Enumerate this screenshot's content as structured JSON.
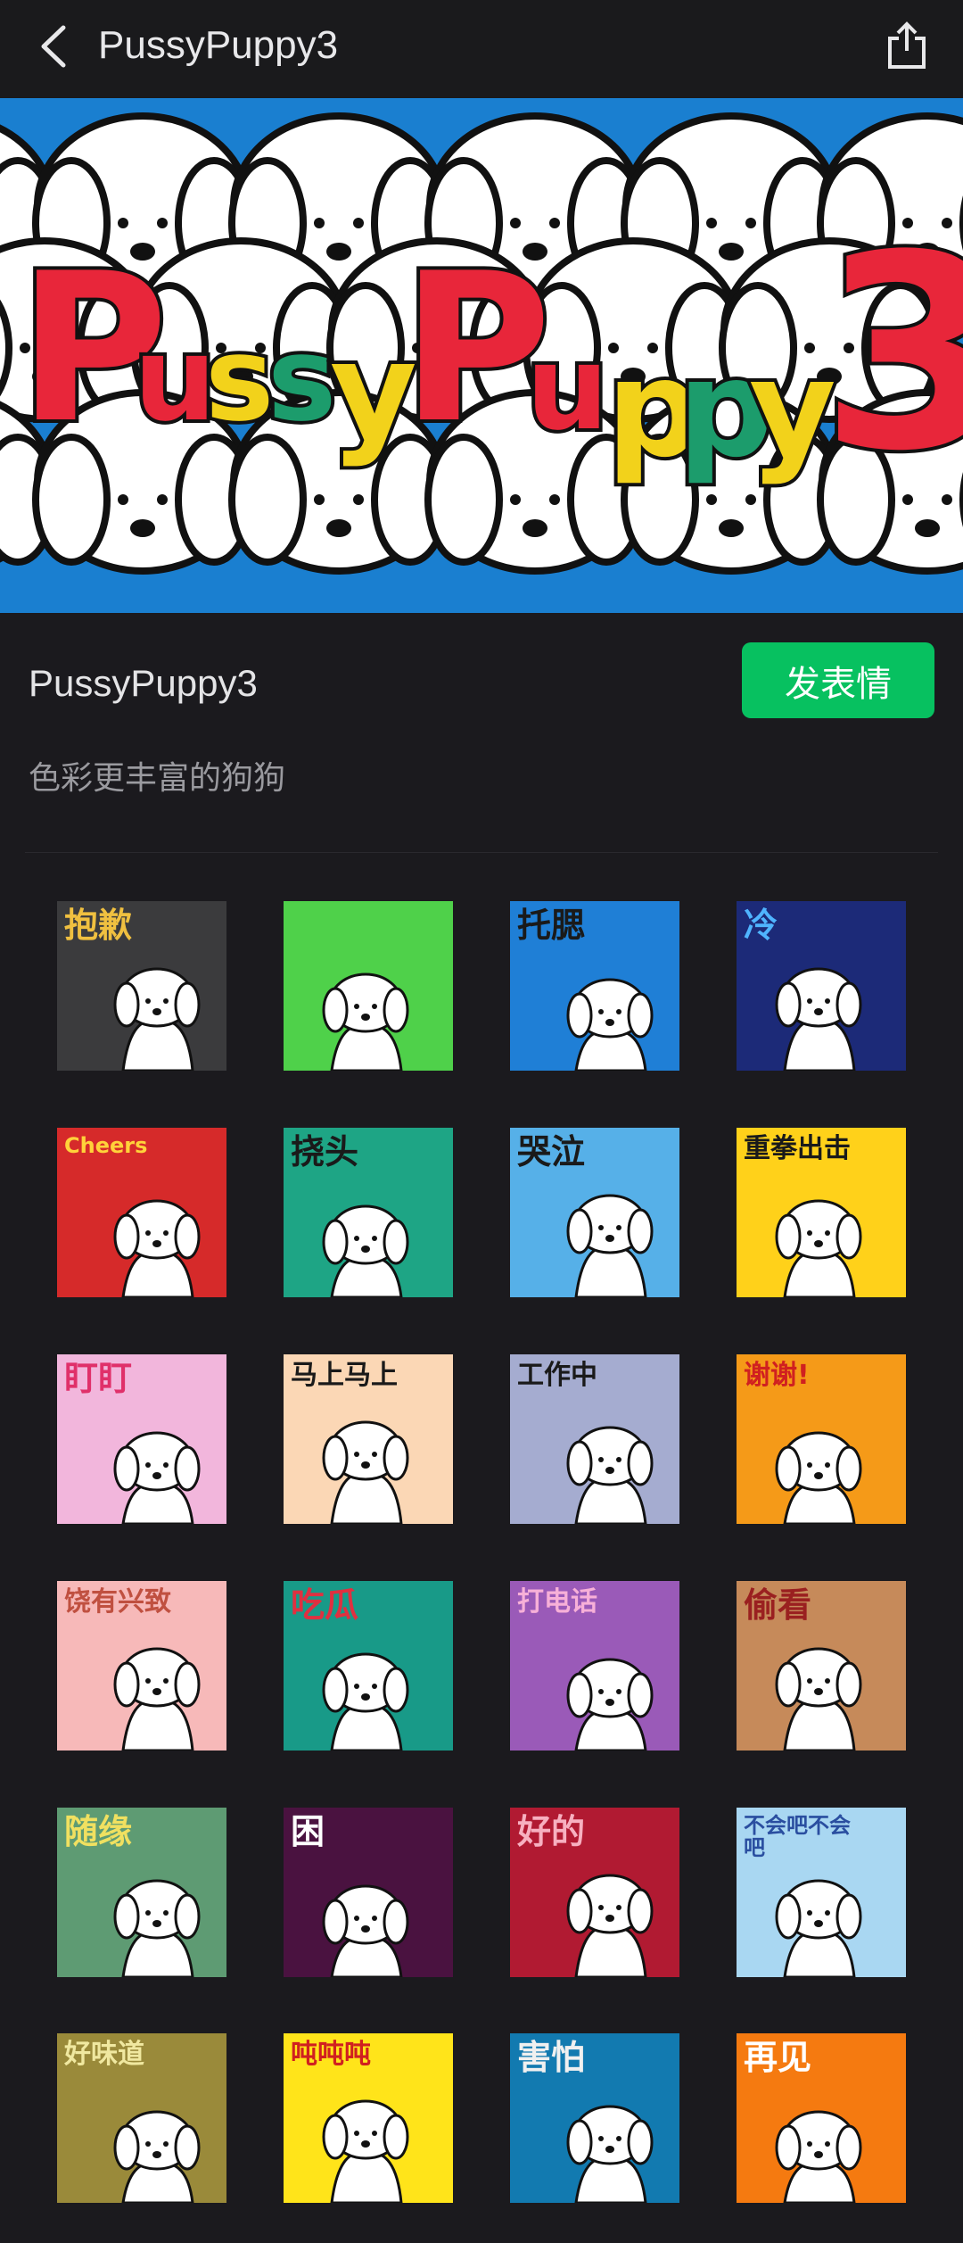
{
  "topbar": {
    "title": "PussyPuppy3",
    "back_icon": "chevron-left-icon",
    "share_icon": "share-icon"
  },
  "banner": {
    "text_letters": [
      "P",
      "u",
      "s",
      "s",
      "y",
      "P",
      "u",
      "p",
      "p",
      "y",
      "3"
    ]
  },
  "pack": {
    "name": "PussyPuppy3",
    "send_label": "发表情",
    "description": "色彩更丰富的狗狗",
    "accent": "#07c160"
  },
  "stickers": [
    {
      "caption": "抱歉",
      "bg": "#3b3b3d",
      "fg": "#f0c040"
    },
    {
      "caption": "",
      "bg": "#4fd14a",
      "fg": "#222222"
    },
    {
      "caption": "托腮",
      "bg": "#1f7fd6",
      "fg": "#1a1a1a"
    },
    {
      "caption": "冷",
      "bg": "#1c2a78",
      "fg": "#4fb4ff"
    },
    {
      "caption": "Cheers",
      "bg": "#d62a2a",
      "fg": "#ffd23a"
    },
    {
      "caption": "挠头",
      "bg": "#1ea585",
      "fg": "#1a1a1a"
    },
    {
      "caption": "哭泣",
      "bg": "#56b0e8",
      "fg": "#1a1a1a"
    },
    {
      "caption": "重拳出击",
      "bg": "#ffd11a",
      "fg": "#1a1a1a"
    },
    {
      "caption": "盯盯",
      "bg": "#f2b6dc",
      "fg": "#e0306a"
    },
    {
      "caption": "马上马上",
      "bg": "#fbd7b5",
      "fg": "#1a1a1a"
    },
    {
      "caption": "工作中",
      "bg": "#a5acd0",
      "fg": "#1a1a1a"
    },
    {
      "caption": "谢谢!",
      "bg": "#f59a18",
      "fg": "#d02020"
    },
    {
      "caption": "饶有兴致",
      "bg": "#f7b9b9",
      "fg": "#c05040"
    },
    {
      "caption": "吃瓜",
      "bg": "#189a88",
      "fg": "#e03040"
    },
    {
      "caption": "打电话",
      "bg": "#9a5ab8",
      "fg": "#f7b0d8"
    },
    {
      "caption": "偷看",
      "bg": "#c68a5a",
      "fg": "#9a2020"
    },
    {
      "caption": "随缘",
      "bg": "#5e9b73",
      "fg": "#f0e060"
    },
    {
      "caption": "困",
      "bg": "#4a1240",
      "fg": "#ffffff"
    },
    {
      "caption": "好的",
      "bg": "#b11a32",
      "fg": "#f7b0c0"
    },
    {
      "caption": "不会吧不会吧",
      "bg": "#a9d7f2",
      "fg": "#2a4ea0"
    },
    {
      "caption": "好味道",
      "bg": "#9a8a3a",
      "fg": "#f0e8a0"
    },
    {
      "caption": "吨吨吨",
      "bg": "#ffe41a",
      "fg": "#d02020"
    },
    {
      "caption": "害怕",
      "bg": "#127ab0",
      "fg": "#f0f0f0"
    },
    {
      "caption": "再见",
      "bg": "#f57a10",
      "fg": "#ffffff"
    }
  ]
}
